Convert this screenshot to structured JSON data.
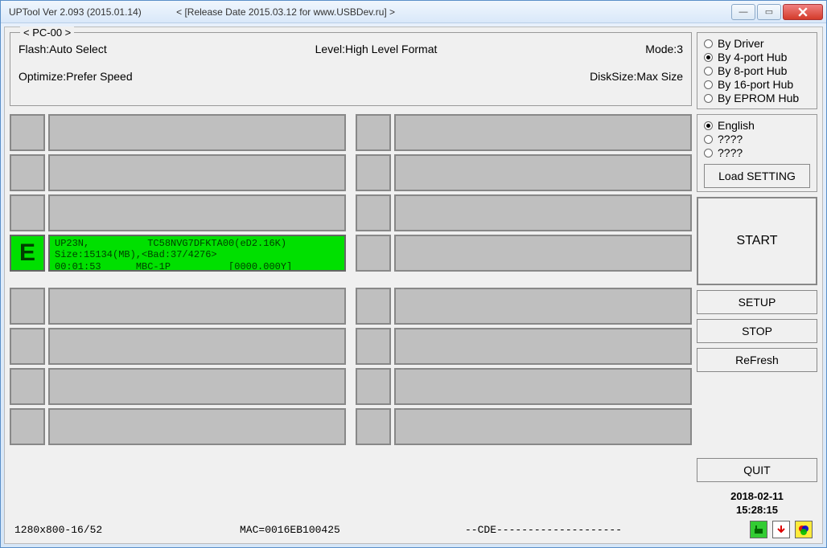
{
  "window": {
    "title_main": "UPTool Ver 2.093 (2015.01.14)",
    "title_release": "<  [Release Date 2015.03.12 for www.USBDev.ru]  >"
  },
  "info": {
    "pc_name": "< PC-00 >",
    "flash_label": "Flash:",
    "flash_value": "Auto Select",
    "level_label": "Level:",
    "level_value": "High Level Format",
    "mode_label": "Mode:",
    "mode_value": "3",
    "optimize_label": "Optimize:",
    "optimize_value": "Prefer Speed",
    "disksize_label": "DiskSize:",
    "disksize_value": "Max Size"
  },
  "hub_options": [
    {
      "label": "By Driver",
      "selected": false
    },
    {
      "label": "By 4-port Hub",
      "selected": true
    },
    {
      "label": "By 8-port Hub",
      "selected": false
    },
    {
      "label": "By 16-port Hub",
      "selected": false
    },
    {
      "label": "By EPROM Hub",
      "selected": false
    }
  ],
  "lang_options": [
    {
      "label": "English",
      "selected": true
    },
    {
      "label": "????",
      "selected": false
    },
    {
      "label": "????",
      "selected": false
    }
  ],
  "buttons": {
    "load_setting": "Load SETTING",
    "start": "START",
    "setup": "SETUP",
    "stop": "STOP",
    "refresh": "ReFresh",
    "quit": "QUIT"
  },
  "timestamp": {
    "date": "2018-02-11",
    "time": "15:28:15"
  },
  "active_slot": {
    "letter": "E",
    "line1": "UP23N,          TC58NVG7DFKTA00(eD2.16K)",
    "line2": "Size:15134(MB),<Bad:37/4276>",
    "line3": "00:01:53      MBC-1P          [0000.000Y]"
  },
  "status": {
    "res": "1280x800-16/52",
    "mac": "MAC=0016EB100425",
    "cde": "--CDE--------------------"
  }
}
